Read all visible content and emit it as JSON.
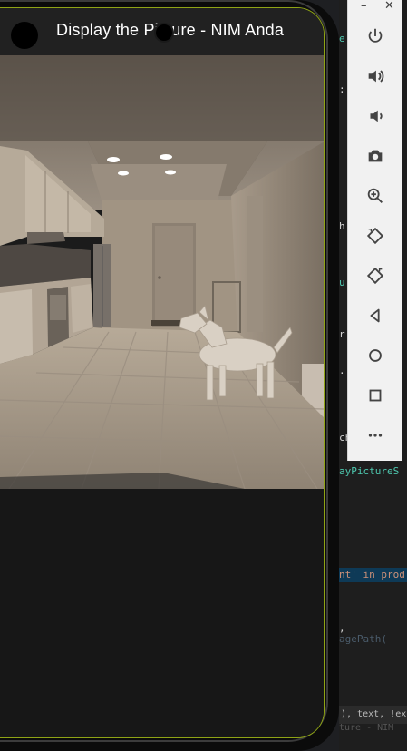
{
  "app": {
    "title": "Display the Picture - NIM Anda"
  },
  "emulator_toolbar": {
    "minimize": "–",
    "close": "✕",
    "buttons": [
      {
        "name": "power-icon"
      },
      {
        "name": "volume-up-icon"
      },
      {
        "name": "volume-down-icon"
      },
      {
        "name": "camera-icon"
      },
      {
        "name": "zoom-icon"
      },
      {
        "name": "rotate-left-icon"
      },
      {
        "name": "rotate-right-icon"
      },
      {
        "name": "back-icon"
      },
      {
        "name": "home-icon"
      },
      {
        "name": "overview-icon"
      },
      {
        "name": "more-icon"
      }
    ]
  },
  "editor": {
    "snippets": [
      "e",
      ":",
      "u",
      "h",
      "r",
      ".",
      "ch",
      "ayPictureS",
      "nt' in prod",
      ",",
      "agePath(",
      "), text, !exclude",
      "ture - NIM"
    ]
  },
  "colors": {
    "accent_border": "#8fa415",
    "appbar": "#212121",
    "background": "#1b1b1b"
  }
}
